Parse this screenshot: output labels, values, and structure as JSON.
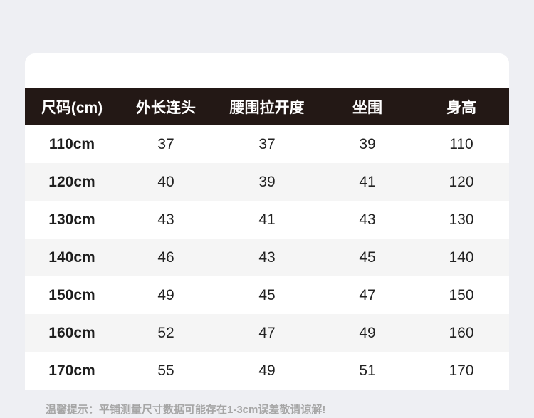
{
  "table": {
    "headers": [
      "尺码(cm)",
      "外长连头",
      "腰围拉开度",
      "坐围",
      "身高"
    ],
    "rows": [
      [
        "110cm",
        "37",
        "37",
        "39",
        "110"
      ],
      [
        "120cm",
        "40",
        "39",
        "41",
        "120"
      ],
      [
        "130cm",
        "43",
        "41",
        "43",
        "130"
      ],
      [
        "140cm",
        "46",
        "43",
        "45",
        "140"
      ],
      [
        "150cm",
        "49",
        "45",
        "47",
        "150"
      ],
      [
        "160cm",
        "52",
        "47",
        "49",
        "160"
      ],
      [
        "170cm",
        "55",
        "49",
        "51",
        "170"
      ]
    ]
  },
  "footer": {
    "note": "温馨提示：平铺测量尺寸数据可能存在1-3cm误差敬请谅解!"
  },
  "colors": {
    "page_background": "#eeeff3",
    "card_background": "#ffffff",
    "header_background": "#231815",
    "header_text": "#ffffff",
    "alt_row_background": "#f5f5f5",
    "cell_text": "#222222",
    "note_text": "#a6a6a6"
  }
}
